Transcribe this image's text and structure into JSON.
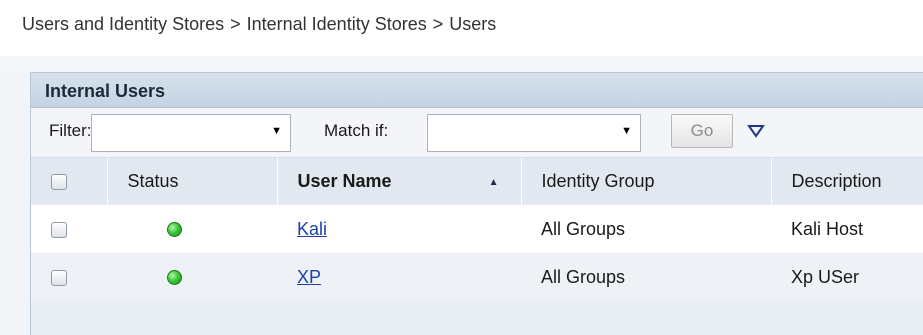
{
  "breadcrumb": {
    "items": [
      "Users and Identity Stores",
      "Internal Identity Stores",
      "Users"
    ],
    "separator": ">"
  },
  "panel": {
    "title": "Internal Users"
  },
  "filter": {
    "filter_label": "Filter:",
    "filter_value": "",
    "match_label": "Match if:",
    "match_value": "",
    "go_label": "Go",
    "more_icon": "triangle-down-icon"
  },
  "table": {
    "columns": [
      "Status",
      "User Name",
      "Identity Group",
      "Description"
    ],
    "sort_column": "User Name",
    "sort_direction": "ascending",
    "rows": [
      {
        "status": "enabled",
        "user_name": "Kali",
        "identity_group": "All Groups",
        "description": "Kali Host"
      },
      {
        "status": "enabled",
        "user_name": "XP",
        "identity_group": "All Groups",
        "description": "Xp USer"
      }
    ]
  },
  "colors": {
    "status_enabled": "#3bc83b",
    "link": "#1f3fa8",
    "header_bg": "#c5d3e2"
  }
}
